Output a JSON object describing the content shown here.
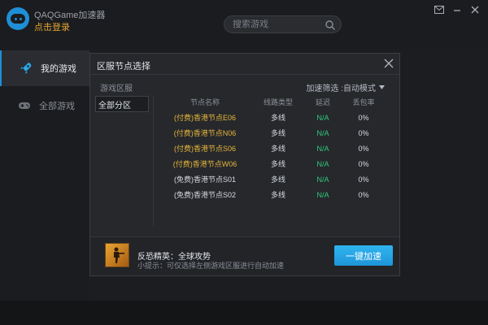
{
  "app": {
    "title": "QAQGame加速器",
    "login": "点击登录"
  },
  "search": {
    "placeholder": "搜索游戏"
  },
  "sidebar": {
    "items": [
      {
        "label": "我的游戏",
        "icon": "rocket-icon",
        "active": true
      },
      {
        "label": "全部游戏",
        "icon": "gamepad-icon",
        "active": false
      }
    ]
  },
  "modal": {
    "title": "区服节点选择",
    "region_header": "游戏区服",
    "filter_label": "加速筛选 :自动模式",
    "regions": [
      "全部分区"
    ],
    "columns": [
      "节点名称",
      "线路类型",
      "延迟",
      "丢包率"
    ],
    "rows": [
      {
        "name": "(付费)香港节点E06",
        "line": "多线",
        "latency": "N/A",
        "loss": "0%",
        "paid": true
      },
      {
        "name": "(付费)香港节点N06",
        "line": "多线",
        "latency": "N/A",
        "loss": "0%",
        "paid": true
      },
      {
        "name": "(付费)香港节点S06",
        "line": "多线",
        "latency": "N/A",
        "loss": "0%",
        "paid": true
      },
      {
        "name": "(付费)香港节点W06",
        "line": "多线",
        "latency": "N/A",
        "loss": "0%",
        "paid": true
      },
      {
        "name": "(免费)香港节点S01",
        "line": "多线",
        "latency": "N/A",
        "loss": "0%",
        "paid": false
      },
      {
        "name": "(免费)香港节点S02",
        "line": "多线",
        "latency": "N/A",
        "loss": "0%",
        "paid": false
      }
    ],
    "game_name": "反恐精英：全球攻势",
    "tip": "小提示：可仅选择左侧游戏区服进行自动加速",
    "accelerate_label": "一键加速"
  },
  "colors": {
    "accent": "#1e8fd6",
    "paid": "#e7b53b",
    "latency": "#2fc87c",
    "button": "#29aae8"
  }
}
